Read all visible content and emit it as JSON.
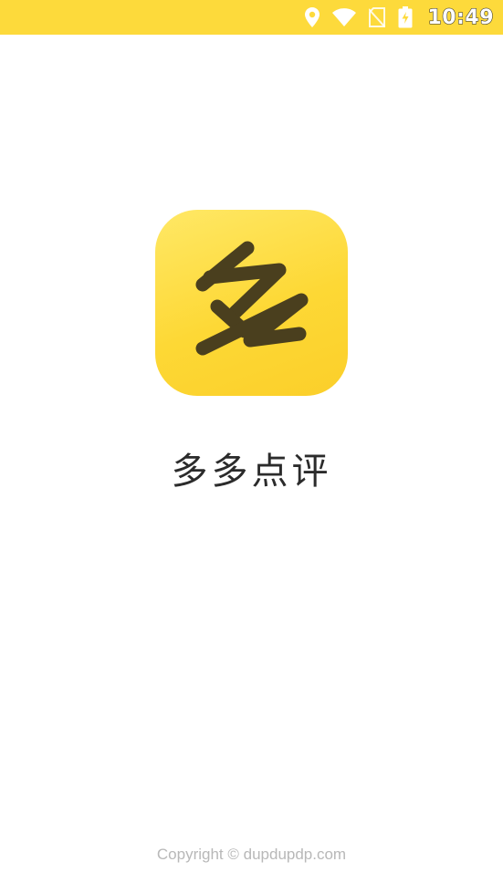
{
  "status_bar": {
    "time": "10:49",
    "background_color": "#fdda3b",
    "icons": [
      "location-icon",
      "wifi-icon",
      "no-sim-icon",
      "battery-charging-icon"
    ]
  },
  "splash": {
    "app_icon": {
      "name": "duoduo-logo-icon",
      "glyph": "多",
      "background_color": "#fdd835",
      "glyph_color": "#4a3f1e"
    },
    "app_name": "多多点评"
  },
  "footer": {
    "copyright": "Copyright © dupdupdp.com"
  }
}
